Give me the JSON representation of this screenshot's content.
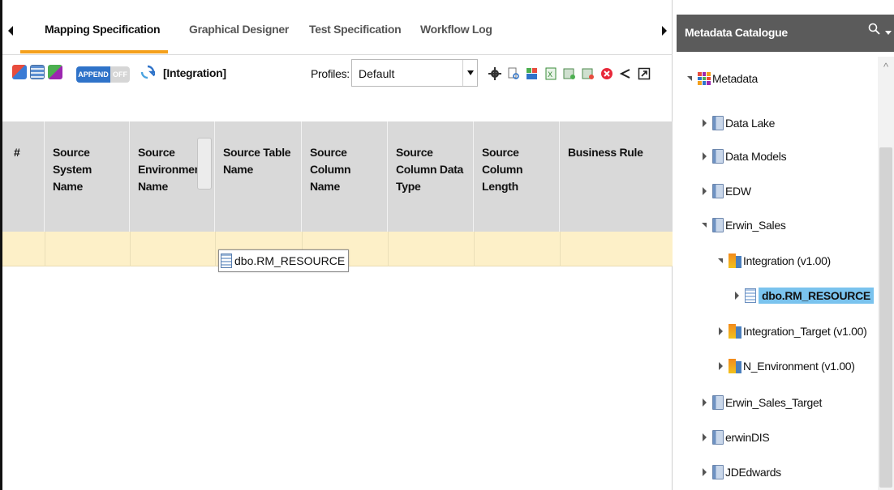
{
  "tabs": [
    {
      "label": "Mapping Specification",
      "active": true
    },
    {
      "label": "Graphical Designer",
      "active": false
    },
    {
      "label": "Test Specification",
      "active": false
    },
    {
      "label": "Workflow Log",
      "active": false
    }
  ],
  "toolbar": {
    "append_on": "APPEND",
    "append_off": "OFF",
    "context": "[Integration]",
    "profiles_label": "Profiles:",
    "profiles_value": "Default"
  },
  "grid": {
    "columns": [
      "#",
      "Source System Name",
      "Source Environment Name",
      "Source Table Name",
      "Source Column Name",
      "Source Column Data Type",
      "Source Column Length",
      "Business Rule"
    ],
    "drag_chip": "dbo.RM_RESOURCE"
  },
  "catalogue": {
    "title": "Metadata Catalogue",
    "root": "Metadata",
    "nodes": [
      "Data Lake",
      "Data Models",
      "EDW",
      "Erwin_Sales",
      "Integration (v1.00)",
      "dbo.RM_RESOURCE",
      "Integration_Target (v1.00)",
      "N_Environment (v1.00)",
      "Erwin_Sales_Target",
      "erwinDIS",
      "JDEdwards"
    ]
  },
  "colors": {
    "accent_underline": "#f4a01c",
    "header_bg": "#d9d9d9",
    "row_highlight": "#fdf0c8",
    "panel_header": "#5b5b5b",
    "selection": "#7ac3ee"
  },
  "icons": [
    "scroll-left-icon",
    "scroll-right-icon",
    "refresh-icon",
    "settings-gear-icon",
    "search-icon",
    "close-circle-icon",
    "share-icon",
    "export-icon"
  ]
}
